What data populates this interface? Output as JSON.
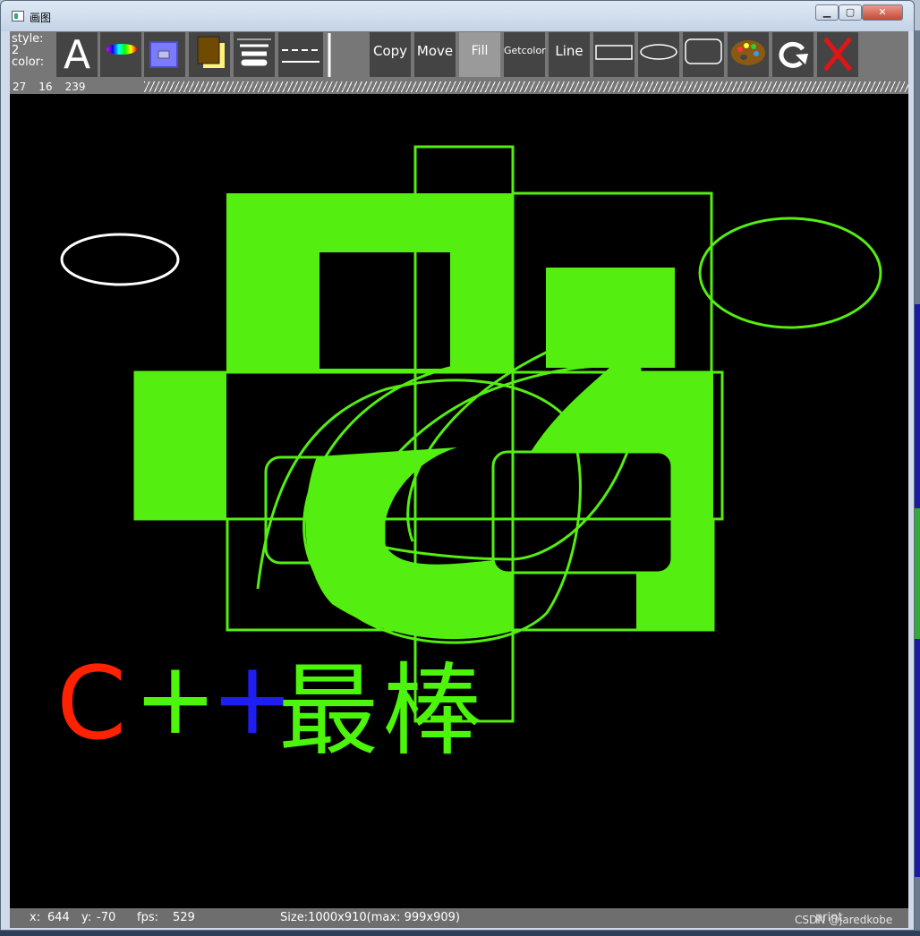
{
  "window": {
    "title": "画图"
  },
  "status": {
    "style_label": "style:",
    "style_value": "2",
    "color_label": "color:",
    "r": "27",
    "g": "16",
    "b": "239"
  },
  "toolbar": {
    "copy": "Copy",
    "move": "Move",
    "fill": "Fill",
    "getcolor": "Getcolor",
    "line": "Line",
    "text_tool": "A",
    "selected": "Fill"
  },
  "canvas": {
    "text_chars": [
      "C",
      "+",
      "+",
      "最",
      "棒"
    ],
    "text_colors": [
      "#ff2200",
      "#4cf50a",
      "#1e1ef0",
      "#4cf50a",
      "#4cf50a"
    ],
    "stroke_color": "#55ee11",
    "ellipse_white": "#ffffff"
  },
  "statusbar": {
    "x_label": "x:",
    "x_value": "644",
    "y_label": "y:",
    "y_value": "-70",
    "fps_label": "fps:",
    "fps_value": "529",
    "size_text": "Size:1000x910(max: 999x909)",
    "print_text": "print"
  },
  "watermark": "CSDN @jaredkobe",
  "colors": {
    "accent_green": "#55ee11",
    "red": "#ff2200",
    "blue": "#1e1ef0",
    "close_red": "#e01515"
  }
}
